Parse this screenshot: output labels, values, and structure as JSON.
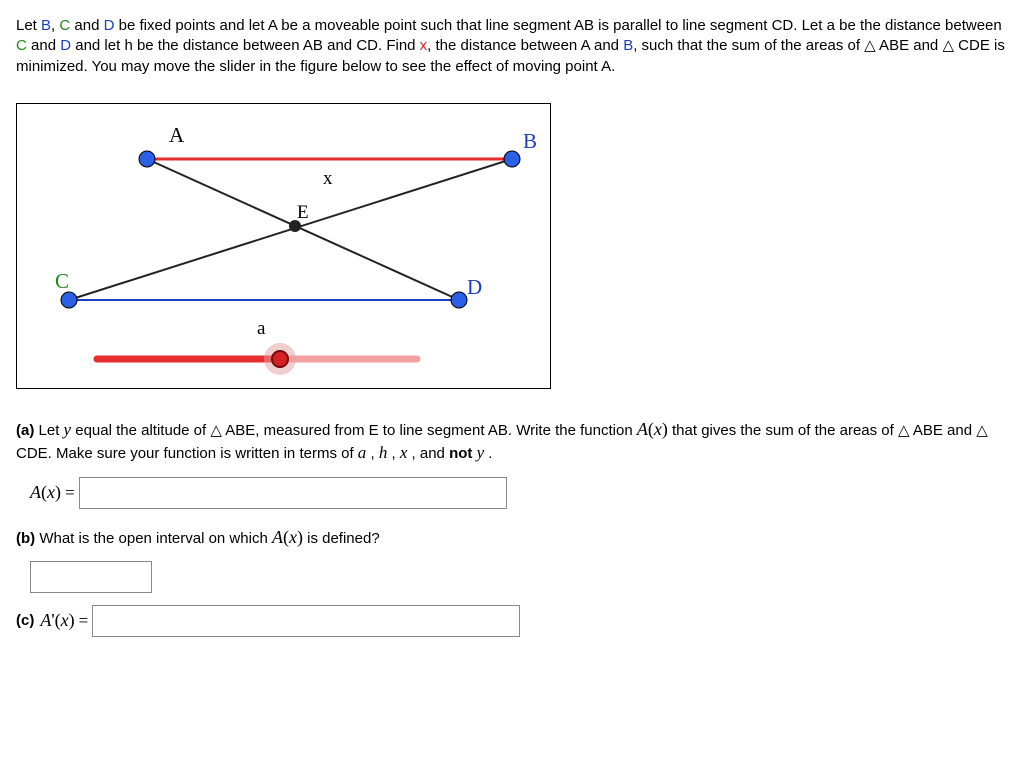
{
  "intro_p1": "Let ",
  "intro_p2": ", ",
  "intro_p3": " and ",
  "intro_p4": " be fixed points and let ",
  "intro_p5": " be a moveable point such that line segment ",
  "intro_p6": " is parallel to line segment ",
  "intro_p7": ". Let ",
  "intro_p8": " be the distance between ",
  "intro_p9": " and ",
  "intro_p10": " and let ",
  "intro_p11": " be the distance between ",
  "intro_p12": " and ",
  "intro_p13": ". Find ",
  "intro_p14": ", the distance between ",
  "intro_p15": " and ",
  "intro_p16": ", such that the sum of the areas of ",
  "intro_p17": " ABE and ",
  "intro_p18": " CDE is minimized. You may move the slider in the figure below to see the effect of moving point ",
  "intro_p19": ".",
  "lbl_A": "A",
  "lbl_B": "B",
  "lbl_C": "C",
  "lbl_D": "D",
  "lbl_E": "E",
  "lbl_x": "x",
  "lbl_a": "a",
  "lbl_h": "h",
  "lbl_y": "y",
  "lbl_AB": "AB",
  "lbl_CD": "CD",
  "tri_sym": "△",
  "part_a_pre": "(a)",
  "part_a_s1": " Let ",
  "part_a_s2": " equal the altitude of ",
  "part_a_s3": " ABE, measured from E to line segment AB. Write the function ",
  "part_a_s4": " that gives the sum of the areas of ",
  "part_a_s5": " ABE and ",
  "part_a_s6": " CDE. Make sure your function is written in terms of ",
  "part_a_s7": " , ",
  "part_a_s8": " , ",
  "part_a_s9": " , and ",
  "part_a_not": "not ",
  "part_a_s10": " .",
  "Aofx": "A(x)",
  "Aprimex": "A'(x)",
  "equals": " = ",
  "part_b_pre": "(b)",
  "part_b_txt": " What is the open interval on which ",
  "part_b_txt2": " is defined?",
  "part_c_pre": "(c)"
}
